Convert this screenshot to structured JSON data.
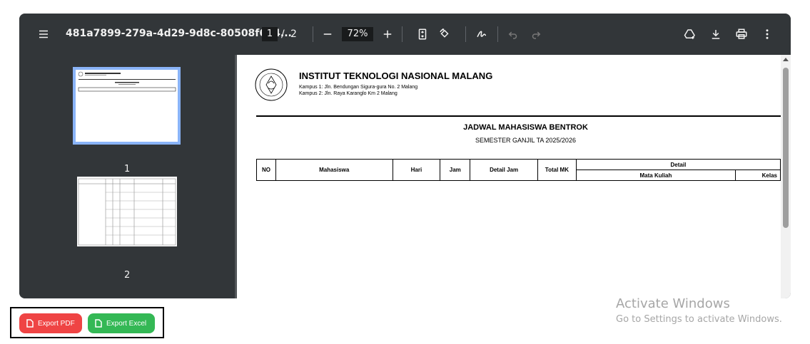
{
  "viewer": {
    "document_title": "481a7899-279a-4d29-9d8c-80508f6d4...",
    "current_page": "1",
    "page_separator": "/",
    "total_pages": "2",
    "zoom": "72%"
  },
  "thumbnails": [
    {
      "label": "1",
      "selected": true
    },
    {
      "label": "2",
      "selected": false
    }
  ],
  "document": {
    "institution": "INSTITUT TEKNOLOGI NASIONAL MALANG",
    "campus1": "Kampus 1: Jln. Bendungan Sigura-gura No. 2 Malang",
    "campus2": "Kampus 2: Jln. Raya Karanglo Km 2 Malang",
    "heading": "JADWAL MAHASISWA BENTROK",
    "subheading": "SEMESTER GANJIL TA 2025/2026",
    "table_headers": {
      "no": "NO",
      "mahasiswa": "Mahasiswa",
      "hari": "Hari",
      "jam": "Jam",
      "detail_jam": "Detail Jam",
      "total_mk": "Total MK",
      "detail": "Detail",
      "mata_kuliah": "Mata Kuliah",
      "kelas": "Kelas"
    }
  },
  "watermark": {
    "line1": "Activate Windows",
    "line2": "Go to Settings to activate Windows."
  },
  "export": {
    "pdf_label": "Export PDF",
    "excel_label": "Export Excel"
  },
  "colors": {
    "toolbar": "#323639",
    "pdf_button": "#ef4444",
    "excel_button": "#34b855",
    "thumb_selected": "#8ab4f8"
  }
}
